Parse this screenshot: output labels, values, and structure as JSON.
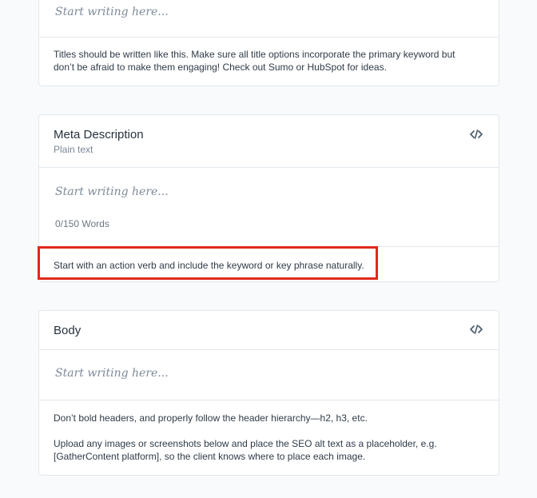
{
  "title_card": {
    "placeholder": "Start writing here...",
    "guideline": "Titles should be written like this. Make sure all title options incorporate the primary keyword but don’t be afraid to make them engaging! Check out Sumo or HubSpot for ideas."
  },
  "meta_card": {
    "title": "Meta Description",
    "subtitle": "Plain text",
    "code_icon": "code-icon",
    "placeholder": "Start writing here...",
    "word_count": "0/150 Words",
    "guideline": "Start with an action verb and include the keyword or key phrase naturally."
  },
  "body_card": {
    "title": "Body",
    "code_icon": "code-icon",
    "placeholder": "Start writing here...",
    "guideline_1": "Don’t bold headers, and properly follow the header hierarchy—h2, h3, etc.",
    "guideline_2": "Upload any images or screenshots below and place the SEO alt text as a placeholder, e.g. [GatherContent platform], so the client knows where to place each image."
  },
  "colors": {
    "highlight": "#e0291a",
    "border": "#e3e8ee",
    "background": "#f8fafc"
  }
}
